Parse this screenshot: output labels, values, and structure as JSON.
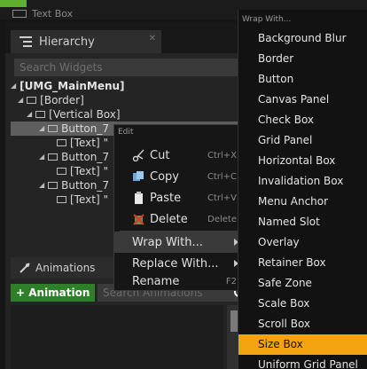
{
  "window": {
    "top_tab_label": "Text Box"
  },
  "hierarchy": {
    "tab_label": "Hierarchy",
    "search_placeholder": "Search Widgets",
    "tree": [
      {
        "label": "[UMG_MainMenu]",
        "level": 0,
        "selected": false
      },
      {
        "label": "[Border]",
        "level": 1,
        "selected": false
      },
      {
        "label": "[Vertical Box]",
        "level": 2,
        "selected": false
      },
      {
        "label": "Button_7",
        "level": 3,
        "selected": true
      },
      {
        "label": "[Text] \"",
        "level": 4,
        "selected": false
      },
      {
        "label": "Button_7",
        "level": 3,
        "selected": false
      },
      {
        "label": "[Text] \"",
        "level": 4,
        "selected": false
      },
      {
        "label": "Button_7",
        "level": 3,
        "selected": false
      },
      {
        "label": "[Text] \"",
        "level": 4,
        "selected": false
      }
    ]
  },
  "animations": {
    "tab_label": "Animations",
    "add_button": "+ Animation",
    "search_placeholder": "Search Animations"
  },
  "context_menu": {
    "header": "Edit",
    "items": [
      {
        "label": "Cut",
        "shortcut": "Ctrl+X",
        "icon": "scissors-icon"
      },
      {
        "label": "Copy",
        "shortcut": "Ctrl+C",
        "icon": "copy-icon"
      },
      {
        "label": "Paste",
        "shortcut": "Ctrl+V",
        "icon": "paste-icon"
      },
      {
        "label": "Delete",
        "shortcut": "Delete",
        "icon": "delete-icon"
      },
      {
        "label": "Wrap With...",
        "shortcut": "",
        "submenu": true,
        "selected": true
      },
      {
        "label": "Replace With...",
        "shortcut": "",
        "submenu": true
      },
      {
        "label": "Rename",
        "shortcut": "F2"
      }
    ]
  },
  "wrap_menu": {
    "header": "Wrap With...",
    "items": [
      "Background Blur",
      "Border",
      "Button",
      "Canvas Panel",
      "Check Box",
      "Grid Panel",
      "Horizontal Box",
      "Invalidation Box",
      "Menu Anchor",
      "Named Slot",
      "Overlay",
      "Retainer Box",
      "Safe Zone",
      "Scale Box",
      "Scroll Box",
      "Size Box",
      "Uniform Grid Panel"
    ],
    "selected_item": "Size Box"
  },
  "colors": {
    "highlight": "#f2a30f",
    "add_button": "#2f7f2a",
    "accent_green": "#5fae2e"
  }
}
